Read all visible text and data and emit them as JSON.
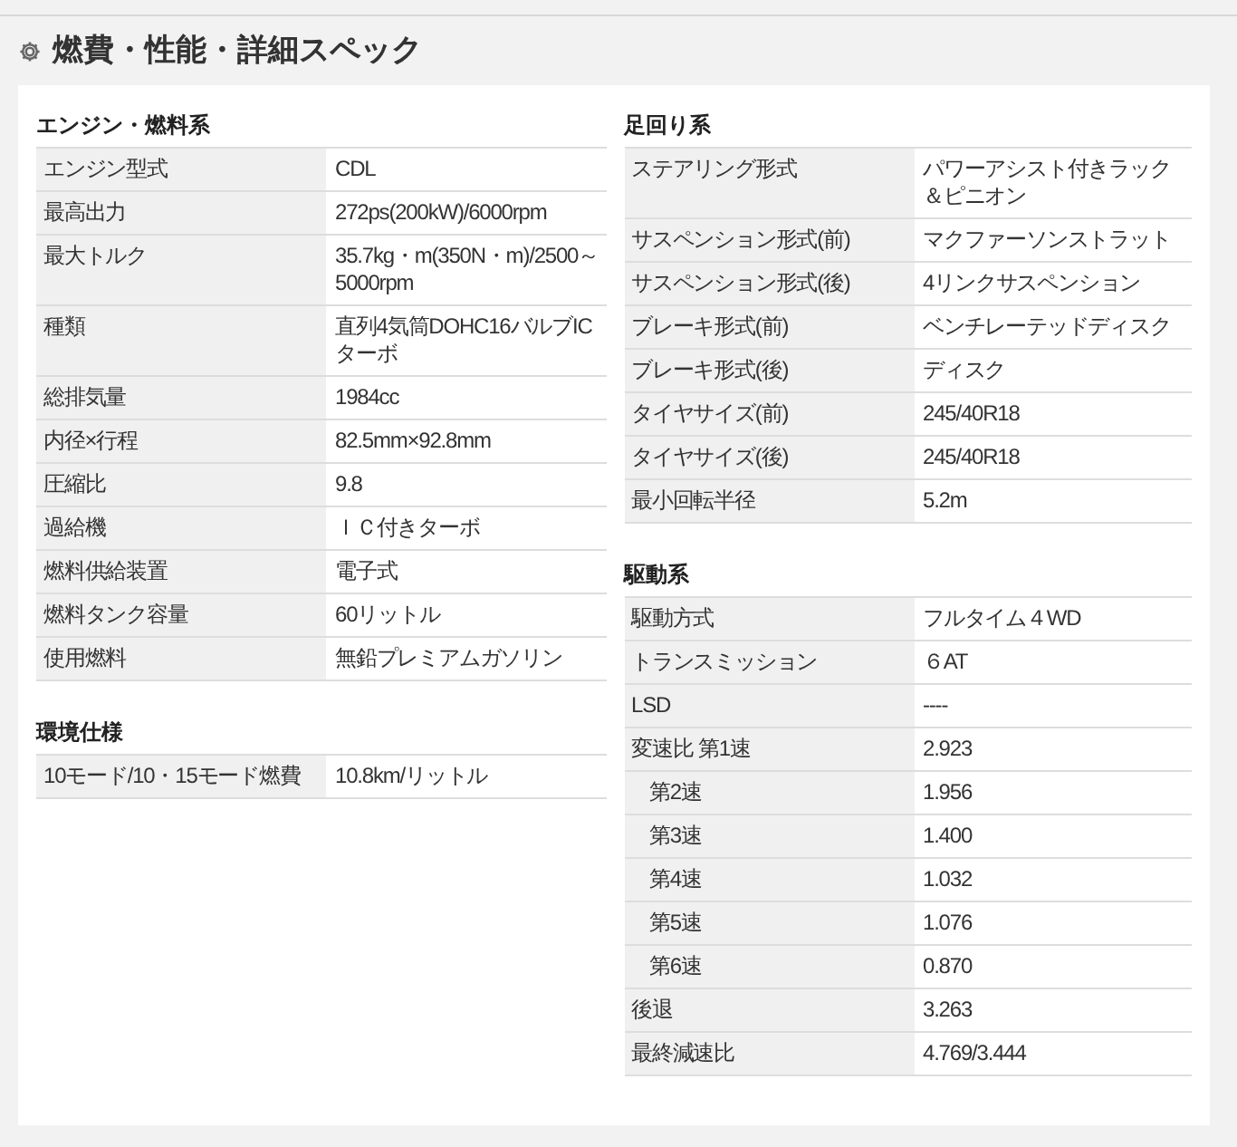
{
  "title": "燃費・性能・詳細スペック",
  "left_sections": [
    {
      "heading": "エンジン・燃料系",
      "rows": [
        {
          "kind": "main",
          "label": "エンジン型式",
          "value": "CDL"
        },
        {
          "kind": "main",
          "label": "最高出力",
          "value": "272ps(200kW)/6000rpm"
        },
        {
          "kind": "main",
          "label": "最大トルク",
          "value": "35.7kg・m(350N・m)/2500～5000rpm"
        },
        {
          "kind": "main",
          "label": "種類",
          "value": "直列4気筒DOHC16バルブICターボ"
        },
        {
          "kind": "main",
          "label": "総排気量",
          "value": "1984cc"
        },
        {
          "kind": "main",
          "label": "内径×行程",
          "value": "82.5mm×92.8mm"
        },
        {
          "kind": "main",
          "label": "圧縮比",
          "value": "9.8"
        },
        {
          "kind": "main",
          "label": "過給機",
          "value": "ＩＣ付きターボ"
        },
        {
          "kind": "main",
          "label": "燃料供給装置",
          "value": "電子式"
        },
        {
          "kind": "main",
          "label": "燃料タンク容量",
          "value": "60リットル"
        },
        {
          "kind": "main",
          "label": "使用燃料",
          "value": "無鉛プレミアムガソリン"
        }
      ]
    },
    {
      "heading": "環境仕様",
      "rows": [
        {
          "kind": "main",
          "label": "10モード/10・15モード燃費",
          "value": "10.8km/リットル"
        }
      ]
    }
  ],
  "right_sections": [
    {
      "heading": "足回り系",
      "rows": [
        {
          "kind": "main",
          "label": "ステアリング形式",
          "value": "パワーアシスト付きラック＆ピニオン"
        },
        {
          "kind": "main",
          "label": "サスペンション形式(前)",
          "value": "マクファーソンストラット"
        },
        {
          "kind": "main",
          "label": "サスペンション形式(後)",
          "value": "4リンクサスペンション"
        },
        {
          "kind": "main",
          "label": "ブレーキ形式(前)",
          "value": "ベンチレーテッドディスク"
        },
        {
          "kind": "main",
          "label": "ブレーキ形式(後)",
          "value": "ディスク"
        },
        {
          "kind": "main",
          "label": "タイヤサイズ(前)",
          "value": "245/40R18"
        },
        {
          "kind": "main",
          "label": "タイヤサイズ(後)",
          "value": "245/40R18"
        },
        {
          "kind": "main",
          "label": "最小回転半径",
          "value": "5.2m"
        }
      ]
    },
    {
      "heading": "駆動系",
      "rows": [
        {
          "kind": "main",
          "label": "駆動方式",
          "value": "フルタイム４WD"
        },
        {
          "kind": "main",
          "label": "トランスミッション",
          "value": "６AT"
        },
        {
          "kind": "main",
          "label": "LSD",
          "value": "----"
        },
        {
          "kind": "main",
          "label": "変速比 第1速",
          "value": "2.923"
        },
        {
          "kind": "sub",
          "label": "第2速",
          "value": "1.956"
        },
        {
          "kind": "sub",
          "label": "第3速",
          "value": "1.400"
        },
        {
          "kind": "sub",
          "label": "第4速",
          "value": "1.032"
        },
        {
          "kind": "sub",
          "label": "第5速",
          "value": "1.076"
        },
        {
          "kind": "sub",
          "label": "第6速",
          "value": "0.870"
        },
        {
          "kind": "main",
          "label": "後退",
          "value": "3.263"
        },
        {
          "kind": "main",
          "label": "最終減速比",
          "value": "4.769/3.444"
        }
      ]
    }
  ]
}
